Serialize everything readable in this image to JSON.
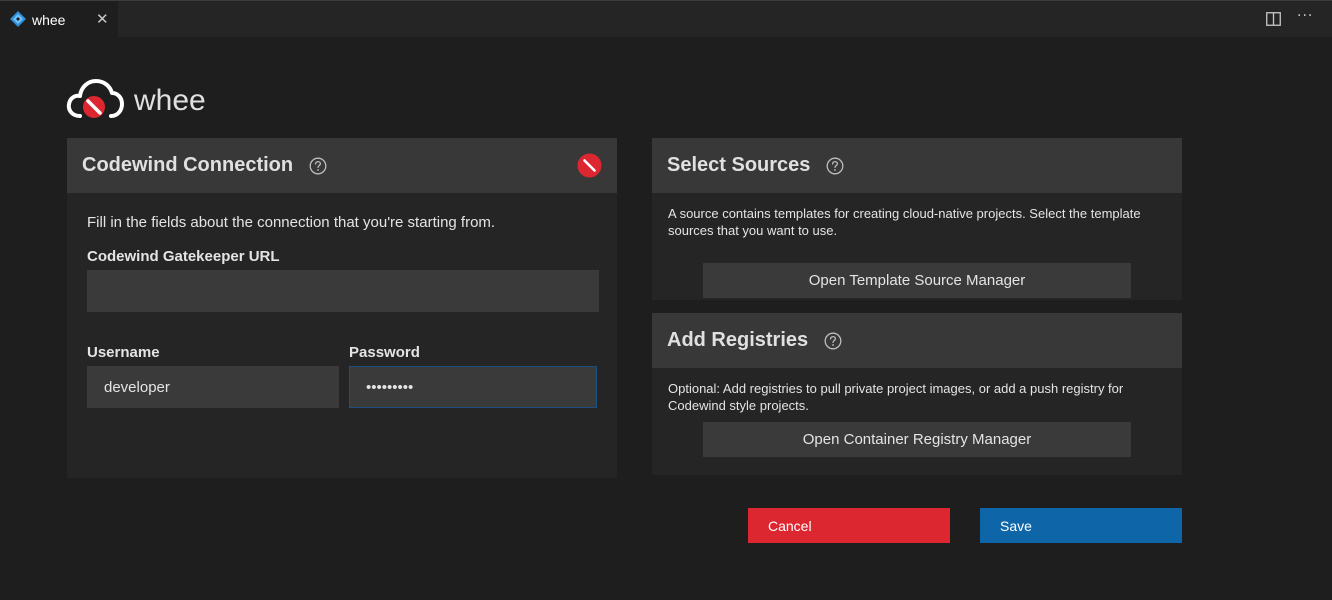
{
  "tab": {
    "title": "whee",
    "close_glyph": "✕"
  },
  "header": {
    "title": "whee",
    "logo_icon": "codewind-cloud-icon"
  },
  "editor_actions": {
    "more_glyph": "···"
  },
  "connection": {
    "title": "Codewind Connection",
    "description": "Fill in the fields about the connection that you're starting from.",
    "url_label": "Codewind Gatekeeper URL",
    "url_value": "",
    "username_label": "Username",
    "username_value": "developer",
    "password_label": "Password",
    "password_value": "•••••••••",
    "status": "disconnected"
  },
  "sources": {
    "title": "Select Sources",
    "description": "A source contains templates for creating cloud-native projects. Select the template sources that you want to use.",
    "button_label": "Open Template Source Manager"
  },
  "registries": {
    "title": "Add Registries",
    "description": "Optional: Add registries to pull private project images, or add a push registry for Codewind style projects.",
    "button_label": "Open Container Registry Manager"
  },
  "actions": {
    "cancel_label": "Cancel",
    "save_label": "Save"
  },
  "colors": {
    "background": "#1e1e1e",
    "panel": "#252526",
    "panel_header": "#383838",
    "cancel": "#dc2630",
    "save": "#0e65a8",
    "error_red": "#dc2630"
  }
}
